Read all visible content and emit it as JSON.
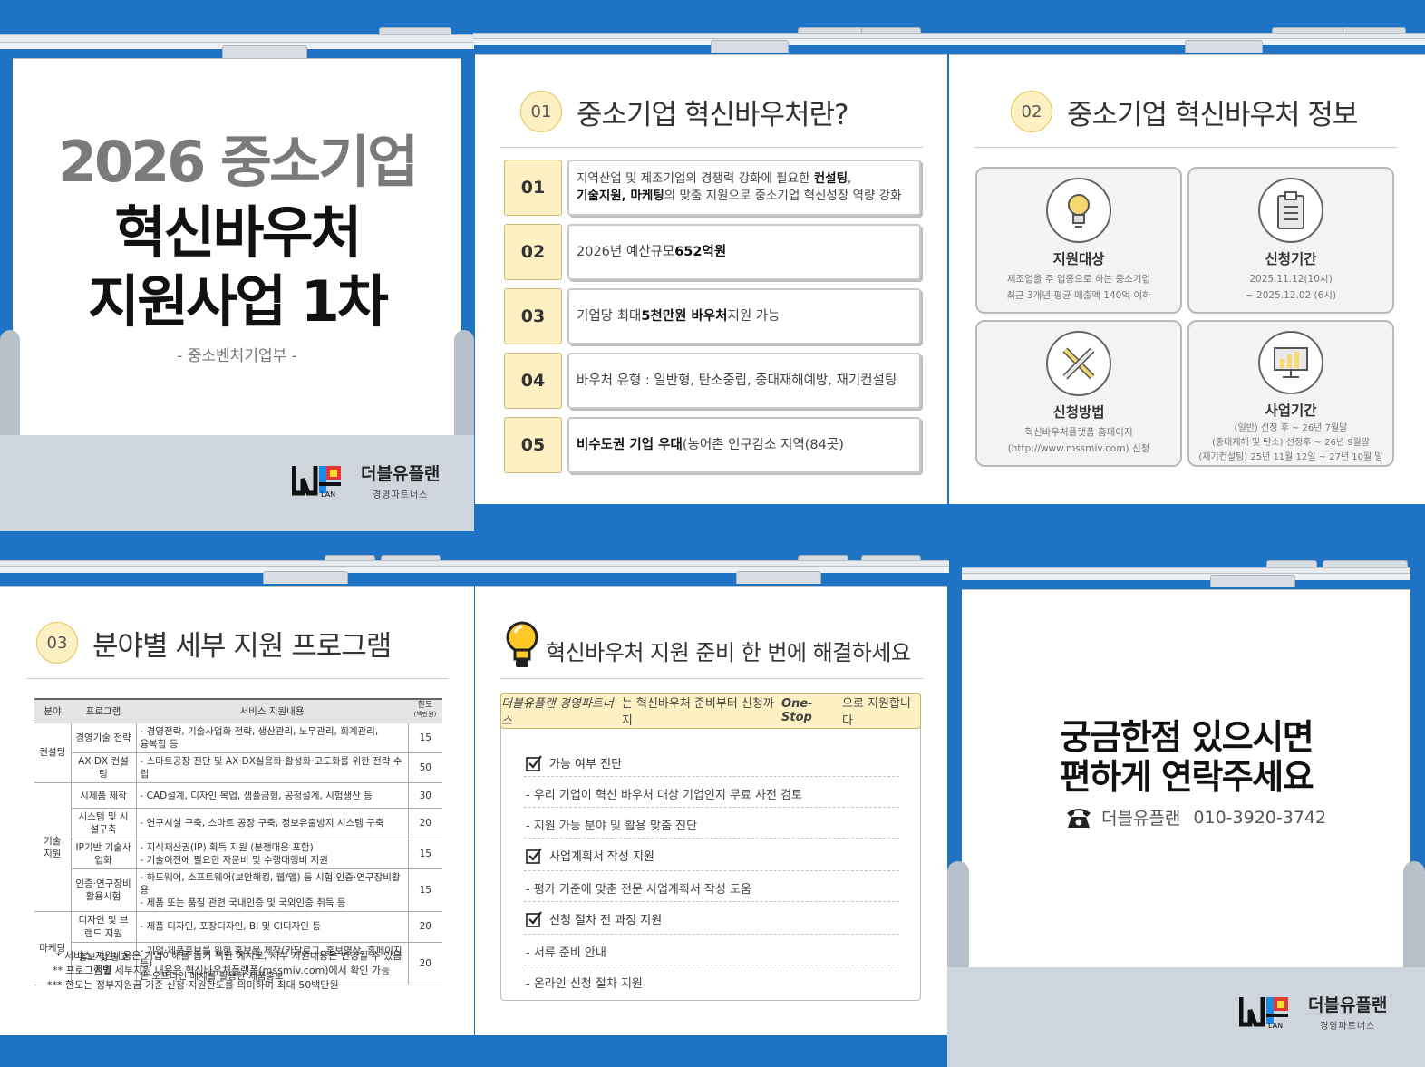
{
  "colors": {
    "background": "#1f73c4",
    "accent_yellow": "#fdf1c4",
    "border": "#c9c9c9"
  },
  "cover": {
    "title_line1": "2026 중소기업",
    "title_line2": "혁신바우처",
    "title_line3": "지원사업 1차",
    "subtitle": "- 중소벤처기업부 -"
  },
  "logo": {
    "name": "더블유플랜",
    "sub": "경영파트너스",
    "mark_text": "WPLAN"
  },
  "section1": {
    "number": "01",
    "title": "중소기업 혁신바우처란?",
    "rows": [
      {
        "num": "01",
        "line1_pre": "지역산업 및 제조기업의 경쟁력 강화에 필요한 ",
        "line1_bold": "컨설팅",
        "line1_post": ",",
        "line2_bold": "기술지원, 마케팅",
        "line2_post": "의 맞춤 지원으로 중소기업 혁신성장 역량 강화"
      },
      {
        "num": "02",
        "pre": "2026년 예산규모 ",
        "bold": "652억원",
        "post": ""
      },
      {
        "num": "03",
        "pre": "기업당 최대 ",
        "bold": "5천만원 바우처",
        "post": " 지원 가능"
      },
      {
        "num": "04",
        "pre": "바우처 유형 : 일반형, 탄소중립, 중대재해예방, 재기컨설팅",
        "bold": "",
        "post": ""
      },
      {
        "num": "05",
        "pre": "",
        "bold": "비수도권 기업 우대",
        "post": " (농어촌 인구감소 지역(84곳)"
      }
    ]
  },
  "section2": {
    "number": "02",
    "title": "중소기업 혁신바우처 정보",
    "cards": [
      {
        "icon": "lightbulb-icon",
        "title": "지원대상",
        "lines": [
          "제조업을 주 업종으로 하는 중소기업",
          "최근 3개년 평균 매출액 140억 이하"
        ]
      },
      {
        "icon": "clipboard-icon",
        "title": "신청기간",
        "lines": [
          "2025.11.12(10시)",
          "~ 2025.12.02 (6시)"
        ]
      },
      {
        "icon": "pencil-ruler-icon",
        "title": "신청방법",
        "lines": [
          "혁신바우처플랫폼 홈페이지",
          "(http://www.mssmiv.com) 신청"
        ]
      },
      {
        "icon": "monitor-chart-icon",
        "title": "사업기간",
        "lines": [
          "(일반) 선정 후 ~ 26년 7월말",
          "(중대재해 및 탄소) 선정후 ~ 26년 9월말",
          "(재기컨설팅) 25년 11월 12일 ~ 27년 10월 말"
        ]
      }
    ]
  },
  "section3": {
    "number": "03",
    "title": "분야별 세부 지원 프로그램",
    "headers": {
      "field": "분야",
      "program": "프로그램",
      "content": "서비스 지원내용",
      "limit": "한도",
      "limit_unit": "(백만원)"
    },
    "groups": [
      {
        "field": "컨설팅",
        "rows": [
          {
            "program": "경영기술 전략",
            "content": [
              "- 경영전략, 기술사업화 전략, 생산관리, 노무관리, 회계관리,",
              "  융복합 등"
            ],
            "limit": "15"
          },
          {
            "program": "AX·DX 컨설팅",
            "content": [
              "- 스마트공장 진단 및 AX·DX실용화·활성화·고도화를 위한 전략 수립"
            ],
            "limit": "50"
          }
        ]
      },
      {
        "field": "기술 지원",
        "rows": [
          {
            "program": "시제품 제작",
            "content": [
              "- CAD설계, 디자인 목업, 샘플금형, 공정설계, 시험생산 등"
            ],
            "limit": "30"
          },
          {
            "program": "시스템 및 시설구축",
            "content": [
              "- 연구시설 구축, 스마트 공장 구축, 정보유출방지 시스템 구축"
            ],
            "limit": "20"
          },
          {
            "program": "IP기반 기술사업화",
            "content": [
              "- 지식재산권(IP) 획득 지원 (분쟁대응 포함)",
              "- 기술이전에 필요한 자문비 및 수행대행비 지원"
            ],
            "limit": "15"
          },
          {
            "program": "인증·연구장비 활용시험",
            "content": [
              "- 하드웨어, 소프트웨어(보안해킹, 웹/앱) 등 시험·인증·연구장비활용",
              "- 제품 또는 품질 관련 국내인증 및 국외인증 취득 등"
            ],
            "limit": "15"
          }
        ]
      },
      {
        "field": "마케팅",
        "rows": [
          {
            "program": "디자인 및 브랜드 지원",
            "content": [
              "- 제품 디자인, 포장디자인, BI 및 CI디자인 등"
            ],
            "limit": "20"
          },
          {
            "program": "홍보 및 광고 지원",
            "content": [
              "- 기업·제품홍보를 위한 홍보물 제작(카달로그, 홍보영상, 홈페이지 등)",
              "  온·오프라인 매체를 활용한 제품홍보"
            ],
            "limit": "20"
          }
        ]
      }
    ],
    "notes": [
      "* 서비스 지원내용은 기업이해를 돕기 위한 예시로, 세부 지원내용은 변경될 수 있음",
      "** 프로그램별 세부지원 내용은 혁신바우처플랫폼(mssmiv.com)에서 확인 가능",
      "*** 한도는 정부지원금 기준 신청·지원한도를 의미하며 최대 50백만원"
    ]
  },
  "section4": {
    "title": "혁신바우처 지원 준비 한 번에 해결하세요",
    "banner_pre": "더블유플랜 경영파트너스",
    "banner_mid": "는 혁신바우처 준비부터 신청까지 ",
    "banner_em": "One-Stop",
    "banner_post": "으로 지원합니다",
    "checks": [
      {
        "label": "가능 여부 진단",
        "items": [
          "- 우리 기업이 혁신 바우처 대상 기업인지 무료 사전 검토",
          "- 지원 가능 분야 및 활용 맞춤 진단"
        ]
      },
      {
        "label": "사업계획서 작성 지원",
        "items": [
          "- 평가 기준에 맞춘 전문 사업계획서 작성 도움"
        ]
      },
      {
        "label": "신청 절차 전 과정 지원",
        "items": [
          "- 서류 준비 안내",
          "- 온라인 신청 절차 지원"
        ]
      }
    ]
  },
  "contact": {
    "line1": "궁금한점 있으시면",
    "line2": "편하게 연락주세요",
    "company": "더블유플랜",
    "phone": "010-3920-3742"
  }
}
